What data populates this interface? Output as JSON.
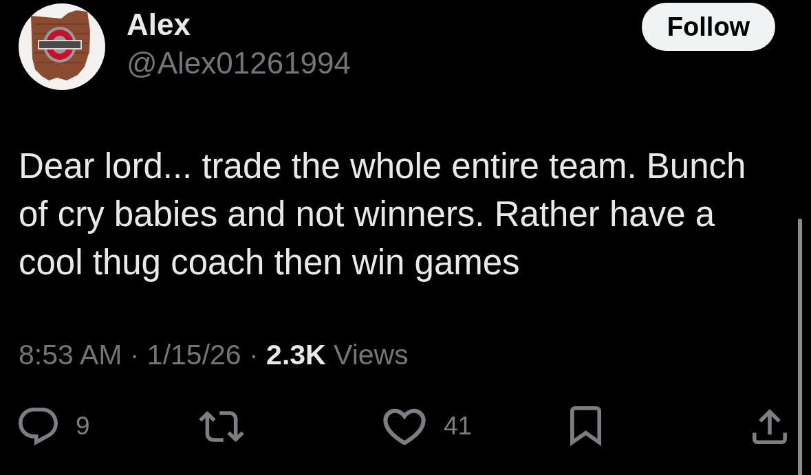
{
  "author": {
    "name": "Alex",
    "handle": "@Alex01261994"
  },
  "follow_button": {
    "label": "Follow"
  },
  "post": {
    "text": "Dear lord... trade the whole entire team. Bunch of cry babies and not winners. Rather have a cool thug coach then win games",
    "meta": "8:53 AM · 1/15/26 · **2.3K** Views"
  },
  "actions": [
    {
      "kind": "reply",
      "count": "9"
    },
    {
      "kind": "repost"
    },
    {
      "kind": "like",
      "count": "41"
    },
    {
      "kind": "bookmark"
    },
    {
      "kind": "share"
    }
  ]
}
